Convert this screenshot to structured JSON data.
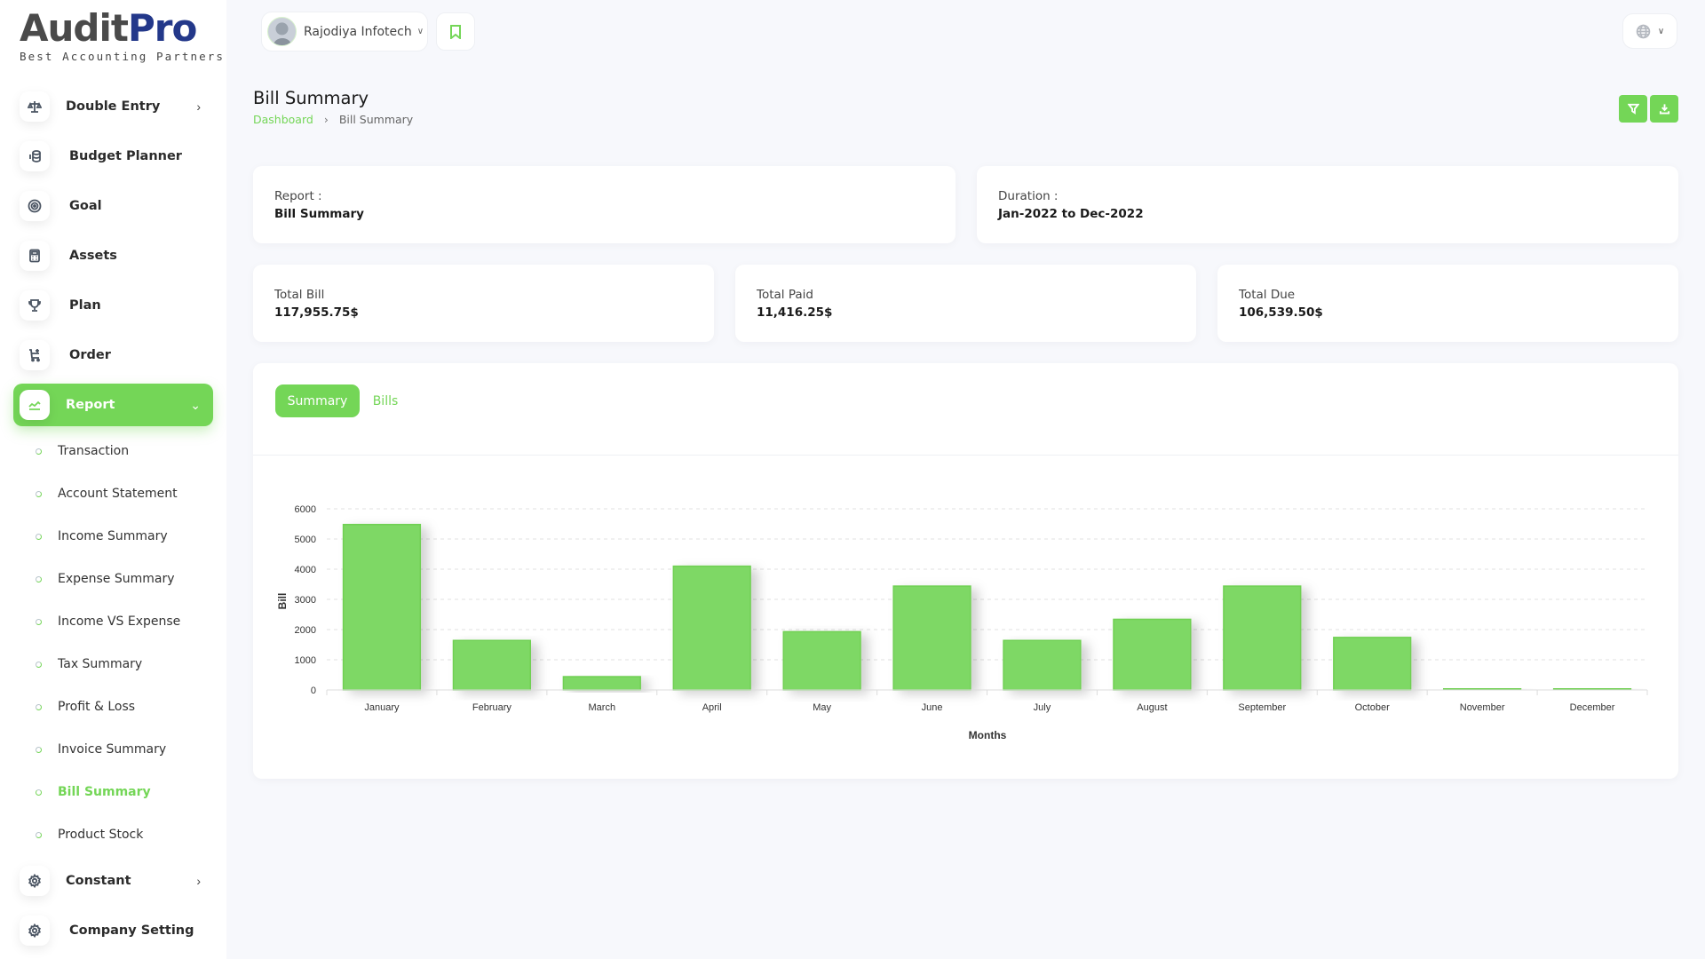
{
  "brand": {
    "name_part1": "Audit",
    "name_part2": "Pro",
    "tagline": "Best Accounting Partners"
  },
  "header": {
    "company_name": "Rajodiya Infotech",
    "bookmark_icon": "bookmark-icon",
    "language_icon": "globe-icon"
  },
  "sidebar": {
    "items": [
      {
        "label": "Double Entry",
        "icon": "scale-icon",
        "has_chevron": true
      },
      {
        "label": "Budget Planner",
        "icon": "coins-icon"
      },
      {
        "label": "Goal",
        "icon": "target-icon"
      },
      {
        "label": "Assets",
        "icon": "calculator-icon"
      },
      {
        "label": "Plan",
        "icon": "trophy-icon"
      },
      {
        "label": "Order",
        "icon": "cart-plus-icon"
      },
      {
        "label": "Report",
        "icon": "chart-line-icon",
        "active": true,
        "expanded": true
      },
      {
        "label": "Constant",
        "icon": "gear-icon",
        "has_chevron": true
      },
      {
        "label": "Company Setting",
        "icon": "gear-icon"
      }
    ],
    "report_subitems": [
      "Transaction",
      "Account Statement",
      "Income Summary",
      "Expense Summary",
      "Income VS Expense",
      "Tax Summary",
      "Profit & Loss",
      "Invoice Summary",
      "Bill Summary",
      "Product Stock"
    ],
    "active_subitem": "Bill Summary"
  },
  "page": {
    "title": "Bill Summary",
    "breadcrumb": [
      "Dashboard",
      "Bill Summary"
    ],
    "actions": {
      "filter_icon": "filter-icon",
      "download_icon": "download-icon"
    }
  },
  "info_cards": {
    "report_label": "Report :",
    "report_value": "Bill Summary",
    "duration_label": "Duration :",
    "duration_value": "Jan-2022 to Dec-2022"
  },
  "stats": [
    {
      "label": "Total Bill",
      "value": "117,955.75$"
    },
    {
      "label": "Total Paid",
      "value": "11,416.25$"
    },
    {
      "label": "Total Due",
      "value": "106,539.50$"
    }
  ],
  "tabs": [
    {
      "label": "Summary",
      "active": true
    },
    {
      "label": "Bills",
      "active": false
    }
  ],
  "colors": {
    "accent": "#74d657",
    "bar": "#7ed865",
    "logo_blue": "#23388a"
  },
  "chart_data": {
    "type": "bar",
    "title": "",
    "xlabel": "Months",
    "ylabel": "Bill",
    "ylim": [
      0,
      6000
    ],
    "yticks": [
      0,
      1000,
      2000,
      3000,
      4000,
      5000,
      6000
    ],
    "grid": true,
    "legend": "none",
    "categories": [
      "January",
      "February",
      "March",
      "April",
      "May",
      "June",
      "July",
      "August",
      "September",
      "October",
      "November",
      "December"
    ],
    "values": [
      5480,
      1640,
      440,
      4100,
      1930,
      3440,
      1640,
      2340,
      3440,
      1740,
      40,
      40
    ]
  }
}
